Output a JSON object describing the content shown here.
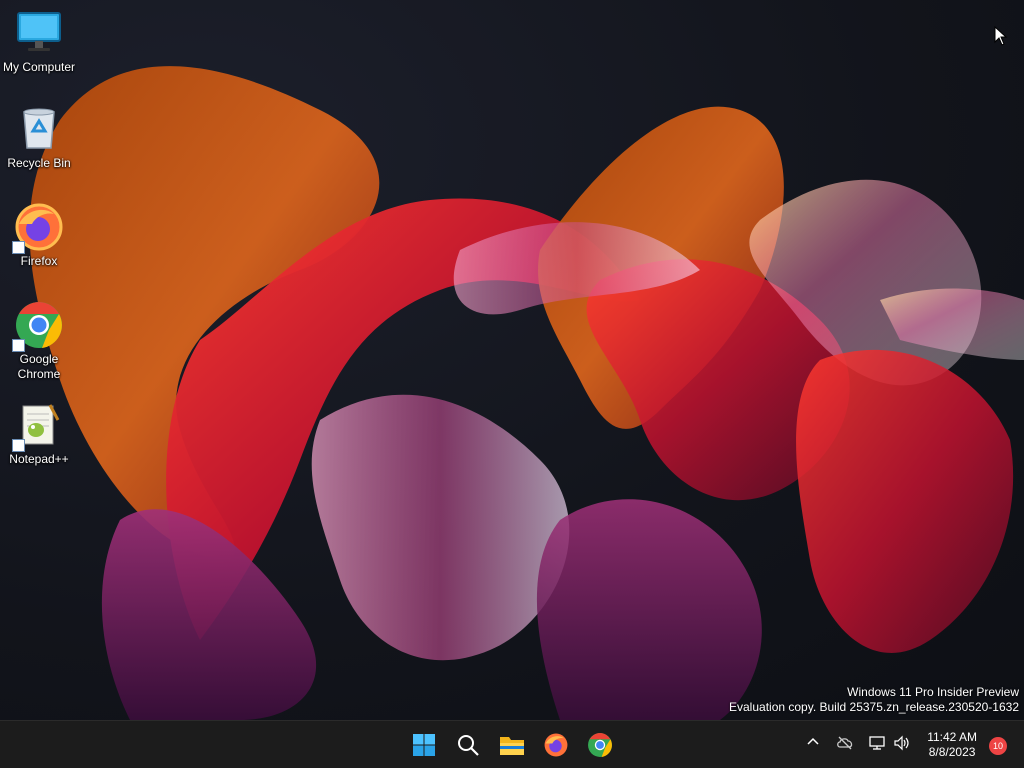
{
  "desktop": {
    "icons": [
      {
        "label": "My Computer",
        "icon": "monitor-icon"
      },
      {
        "label": "Recycle Bin",
        "icon": "recycle-bin-icon"
      },
      {
        "label": "Firefox",
        "icon": "firefox-icon"
      },
      {
        "label": "Google\nChrome",
        "icon": "chrome-icon"
      },
      {
        "label": "Notepad++",
        "icon": "notepadpp-icon"
      }
    ]
  },
  "watermark": {
    "line1": "Windows 11 Pro Insider Preview",
    "line2": "Evaluation copy. Build 25375.zn_release.230520-1632"
  },
  "taskbar": {
    "apps": [
      "start-icon",
      "search-icon",
      "file-explorer-icon",
      "firefox-icon",
      "chrome-icon"
    ],
    "tray": {
      "time": "11:42 AM",
      "date": "8/8/2023",
      "notification_count": "10"
    }
  },
  "colors": {
    "taskbar": "#1c1c1c",
    "accent_start": "#4cc2ff",
    "badge": "#e44"
  }
}
